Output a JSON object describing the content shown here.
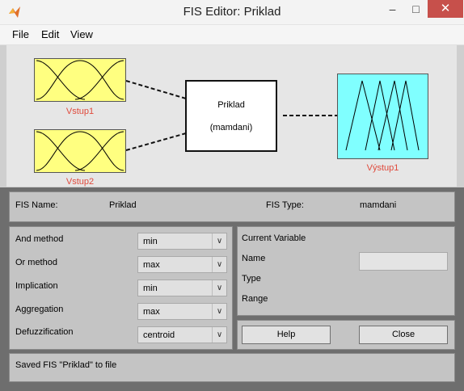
{
  "window": {
    "title": "FIS Editor: Priklad",
    "controls": {
      "minimize": "–",
      "maximize": "□",
      "close": "✕"
    }
  },
  "menu": [
    "File",
    "Edit",
    "View"
  ],
  "diagram": {
    "inputs": [
      "Vstup1",
      "Vstup2"
    ],
    "output": "Výstup1",
    "system_name": "Priklad",
    "system_type": "(mamdani)"
  },
  "info": {
    "fis_name_label": "FIS Name:",
    "fis_name_value": "Priklad",
    "fis_type_label": "FIS Type:",
    "fis_type_value": "mamdani"
  },
  "methods": [
    {
      "label": "And method",
      "value": "min"
    },
    {
      "label": "Or method",
      "value": "max"
    },
    {
      "label": "Implication",
      "value": "min"
    },
    {
      "label": "Aggregation",
      "value": "max"
    },
    {
      "label": "Defuzzification",
      "value": "centroid"
    }
  ],
  "current_variable": {
    "title": "Current Variable",
    "name_label": "Name",
    "name_value": "",
    "type_label": "Type",
    "range_label": "Range"
  },
  "buttons": {
    "help": "Help",
    "close": "Close"
  },
  "status": "Saved FIS \"Priklad\" to file",
  "colors": {
    "input_mf_bg": "#ffff80",
    "output_mf_bg": "#80ffff",
    "var_label": "#e04a3c",
    "close_button": "#c7504b"
  }
}
